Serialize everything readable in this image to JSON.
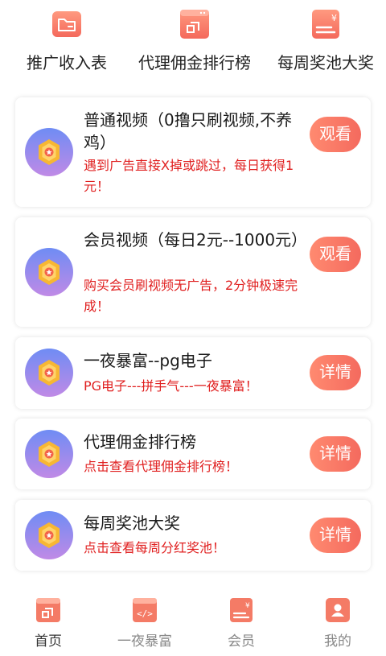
{
  "colors": {
    "accent": "#f46a5e",
    "desc_red": "#e02020",
    "badge_from": "#6f8cf4",
    "badge_to": "#c08ae6"
  },
  "quick_menu": [
    {
      "label": "推广收入表",
      "icon": "folder-icon"
    },
    {
      "label": "代理佣金排行榜",
      "icon": "share-icon"
    },
    {
      "label": "每周奖池大奖",
      "icon": "yen-card-icon"
    }
  ],
  "cards": [
    {
      "title": "普通视频（0撸只刷视频,不养鸡）",
      "desc": "遇到广告直接X掉或跳过，每日获得1元！",
      "action": "观看",
      "icon": "medal-icon"
    },
    {
      "title": "会员视频（每日2元--1000元）",
      "desc": "购买会员刷视频无广告，2分钟极速完成！",
      "action": "观看",
      "icon": "medal-icon"
    },
    {
      "title": "一夜暴富--pg电子",
      "desc": "PG电子---拼手气---一夜暴富！",
      "action": "详情",
      "icon": "medal-icon"
    },
    {
      "title": "代理佣金排行榜",
      "desc": "点击查看代理佣金排行榜！",
      "action": "详情",
      "icon": "medal-icon"
    },
    {
      "title": "每周奖池大奖",
      "desc": "点击查看每周分红奖池！",
      "action": "详情",
      "icon": "medal-icon"
    }
  ],
  "tabs": [
    {
      "label": "首页",
      "icon": "share-icon",
      "active": true
    },
    {
      "label": "一夜暴富",
      "icon": "code-window-icon",
      "active": false
    },
    {
      "label": "会员",
      "icon": "yen-card-icon",
      "active": false
    },
    {
      "label": "我的",
      "icon": "user-icon",
      "active": false
    }
  ]
}
